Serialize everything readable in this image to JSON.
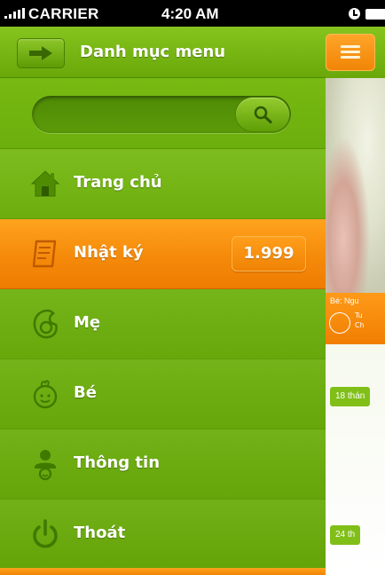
{
  "status_bar": {
    "carrier": "CARRIER",
    "time": "4:20 AM"
  },
  "menu": {
    "title": "Danh mục menu",
    "search": {
      "value": "",
      "placeholder": ""
    },
    "items": [
      {
        "label": "Trang chủ",
        "icon": "home-icon"
      },
      {
        "label": "Nhật ký",
        "icon": "diary-icon",
        "badge": "1.999",
        "active": true
      },
      {
        "label": "Mẹ",
        "icon": "mother-icon"
      },
      {
        "label": "Bé",
        "icon": "baby-icon"
      },
      {
        "label": "Thông tin",
        "icon": "info-person-icon"
      },
      {
        "label": "Thoát",
        "icon": "power-icon"
      }
    ]
  },
  "content": {
    "baby_name": "Bé: Ngu",
    "baby_info_1": "Tu",
    "baby_info_2": "Ch",
    "age_tags": [
      "18 thán",
      "24 th"
    ]
  },
  "colors": {
    "menu_green": "#6cb00c",
    "active_orange": "#f58a0a",
    "text": "#ffffff"
  }
}
